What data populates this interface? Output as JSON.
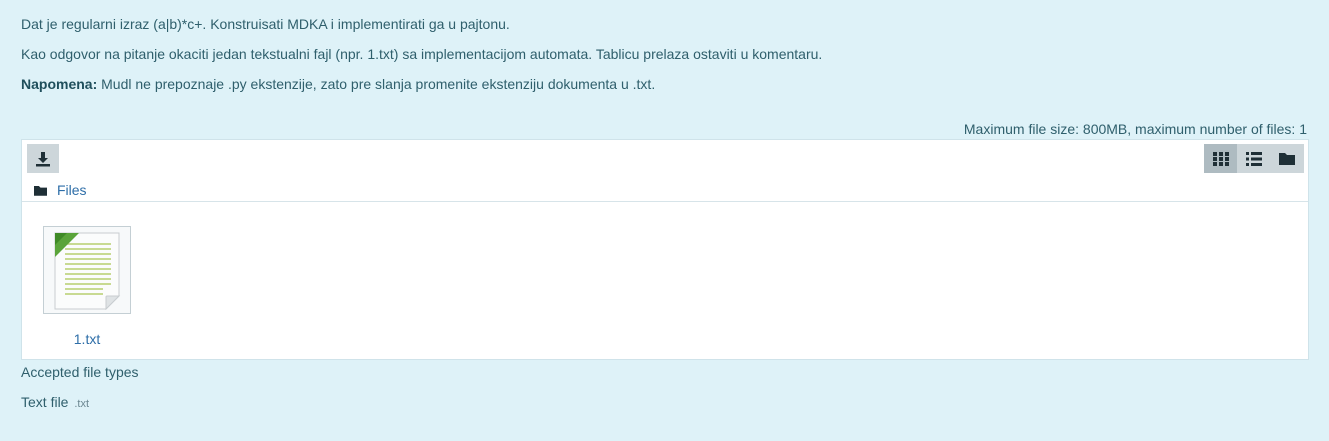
{
  "question": {
    "line1": "Dat je regularni izraz (a|b)*c+. Konstruisati MDKA i implementirati ga u pajtonu.",
    "line2": "Kao odgovor na pitanje okaciti jedan tekstualni fajl (npr. 1.txt) sa implementacijom automata. Tablicu prelaza ostaviti u komentaru.",
    "note_label": "Napomena:",
    "note_text": " Mudl ne prepoznaje .py ekstenzije, zato pre slanja promenite ekstenziju dokumenta u .txt."
  },
  "limits": "Maximum file size: 800MB, maximum number of files: 1",
  "filemanager": {
    "toolbar": {
      "download_icon": "download-icon",
      "views": [
        {
          "name": "view-icons",
          "icon": "grid-icon",
          "active": true
        },
        {
          "name": "view-list",
          "icon": "list-icon",
          "active": false
        },
        {
          "name": "view-tree",
          "icon": "folder-icon",
          "active": false
        }
      ]
    },
    "path": {
      "icon": "folder-icon",
      "label": "Files"
    },
    "files": [
      {
        "name": "1.txt",
        "icon": "text-file-icon"
      }
    ]
  },
  "accepted": {
    "title": "Accepted file types",
    "items": [
      {
        "label": "Text file",
        "ext": ".txt"
      }
    ]
  },
  "colors": {
    "background": "#def2f8",
    "text": "#2f5f6c",
    "link": "#2e6ea8",
    "button": "#cdd6da",
    "button_active": "#aebbc1"
  }
}
